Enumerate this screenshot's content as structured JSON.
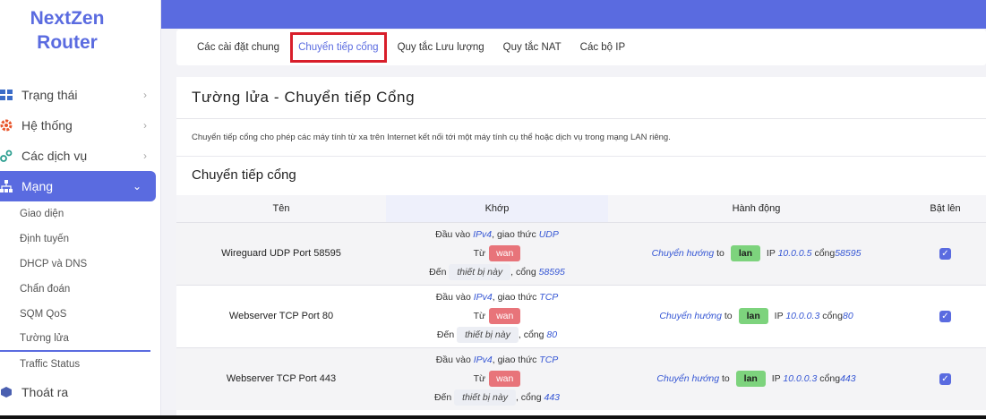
{
  "brand": {
    "line1": "NextZen",
    "line2": "Router"
  },
  "nav": {
    "status": "Trạng thái",
    "system": "Hệ thống",
    "services": "Các dịch vụ",
    "network": "Mạng",
    "logout": "Thoát ra",
    "network_sub": [
      "Giao diện",
      "Định tuyến",
      "DHCP và DNS",
      "Chẩn đoán",
      "SQM QoS",
      "Tường lửa",
      "Traffic Status"
    ]
  },
  "tabs": [
    "Các cài đặt chung",
    "Chuyển tiếp cổng",
    "Quy tắc Lưu lượng",
    "Quy tắc NAT",
    "Các bộ IP"
  ],
  "page": {
    "title": "Tường lửa - Chuyển tiếp Cổng",
    "description": "Chuyển tiếp cổng cho phép các máy tính từ xa trên Internet kết nối tới một máy tính cụ thể hoặc dịch vụ trong mạng LAN riêng.",
    "section_title": "Chuyển tiếp cổng"
  },
  "table": {
    "headers": {
      "name": "Tên",
      "match": "Khớp",
      "action": "Hành động",
      "enable": "Bật lên"
    },
    "labels": {
      "incoming": "Đầu vào",
      "protocol": ", giao thức",
      "from": "Từ",
      "to": "Đến",
      "port_sep": ", cổng",
      "redirect": "Chuyển hướng",
      "to_word": "to",
      "ip": "IP",
      "port_word": "cổng"
    },
    "rows": [
      {
        "name": "Wireguard UDP Port 58595",
        "family": "IPv4",
        "proto": "UDP",
        "src_zone": "wan",
        "dest": "thiết bị này",
        "ext_port": "58595",
        "dest_zone": "lan",
        "dest_ip": "10.0.0.5",
        "dest_port": "58595",
        "enabled": true
      },
      {
        "name": "Webserver TCP Port 80",
        "family": "IPv4",
        "proto": "TCP",
        "src_zone": "wan",
        "dest": "thiết bị này",
        "ext_port": "80",
        "dest_zone": "lan",
        "dest_ip": "10.0.0.3",
        "dest_port": "80",
        "enabled": true
      },
      {
        "name": "Webserver TCP Port 443",
        "family": "IPv4",
        "proto": "TCP",
        "src_zone": "wan",
        "dest": "thiết bị này",
        "ext_port": "443",
        "dest_zone": "lan",
        "dest_ip": "10.0.0.3",
        "dest_port": "443",
        "enabled": true
      }
    ]
  },
  "colors": {
    "accent": "#5a6be0",
    "wan": "#e8747a",
    "lan": "#7dd37d",
    "tab_highlight": "#d81e2a"
  }
}
